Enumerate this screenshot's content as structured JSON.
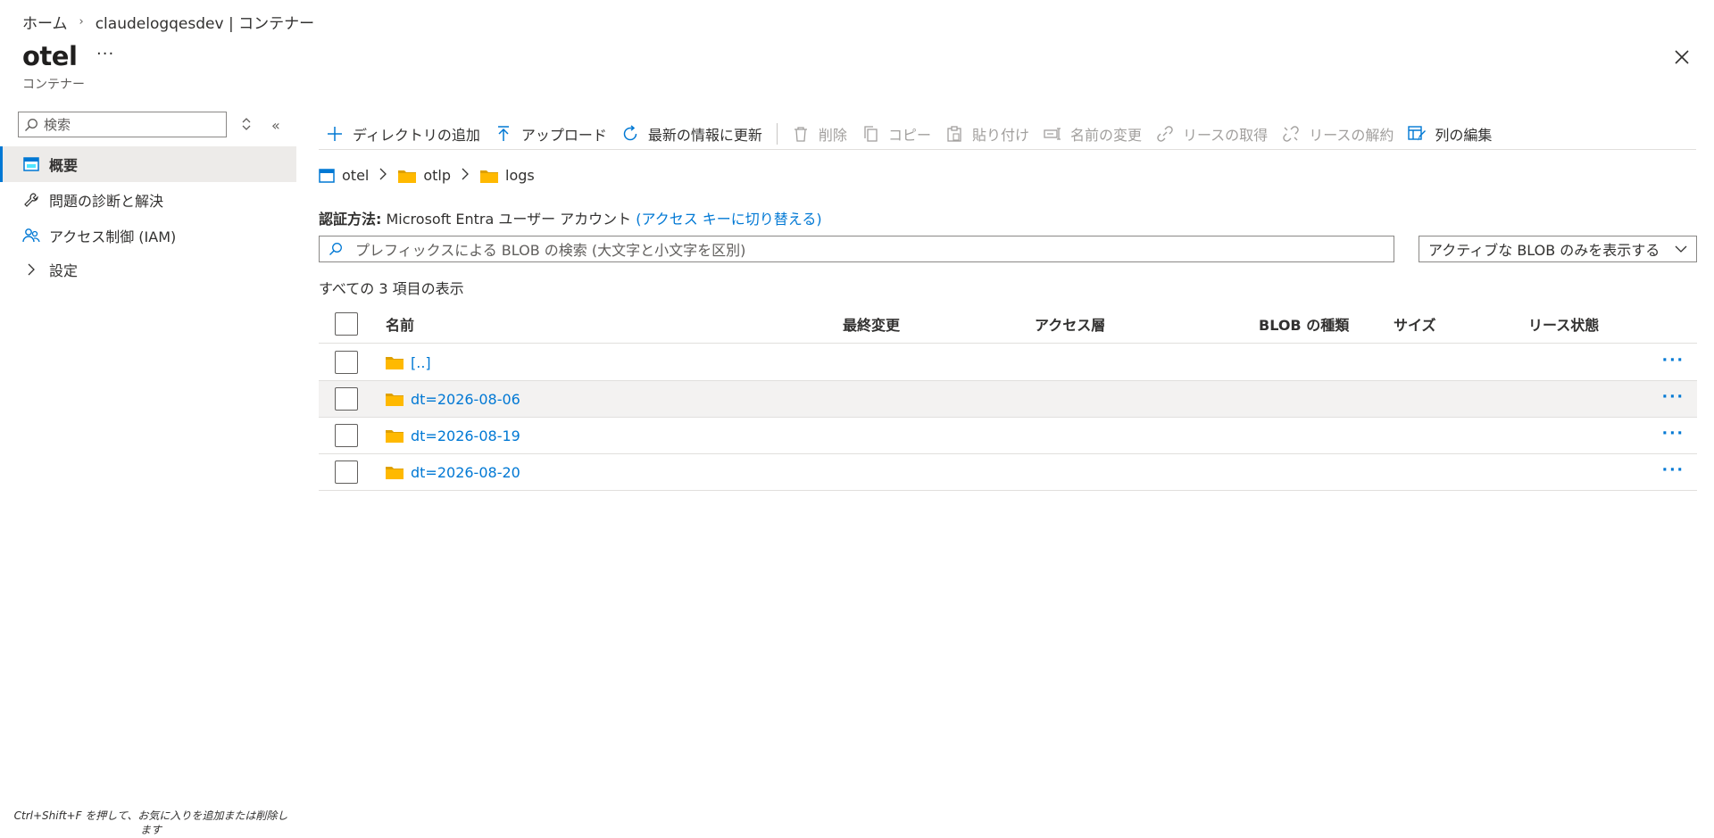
{
  "breadcrumb": {
    "home": "ホーム",
    "current": "claudelogqesdev | コンテナー"
  },
  "page": {
    "title": "otel",
    "more": "···",
    "subtitle": "コンテナー"
  },
  "nav": {
    "search_placeholder": "検索",
    "items": [
      {
        "label": "概要",
        "icon": "overview-icon",
        "active": true
      },
      {
        "label": "問題の診断と解決",
        "icon": "wrench-icon",
        "active": false
      },
      {
        "label": "アクセス制御 (IAM)",
        "icon": "people-icon",
        "active": false
      },
      {
        "label": "設定",
        "icon": "chevron-right-icon",
        "active": false
      }
    ],
    "hint": "Ctrl+Shift+F を押して、お気に入りを追加または削除します"
  },
  "toolbar": {
    "add_dir": "ディレクトリの追加",
    "upload": "アップロード",
    "refresh": "最新の情報に更新",
    "delete": "削除",
    "copy": "コピー",
    "paste": "貼り付け",
    "rename": "名前の変更",
    "acquire_lease": "リースの取得",
    "break_lease": "リースの解約",
    "edit_columns": "列の編集"
  },
  "path": {
    "container": "otel",
    "folder1": "otlp",
    "folder2": "logs"
  },
  "auth": {
    "label": "認証方法:",
    "value": "Microsoft Entra ユーザー アカウント",
    "switch_link": "(アクセス キーに切り替える)"
  },
  "blob_search": {
    "placeholder": "プレフィックスによる BLOB の検索 (大文字と小文字を区別)"
  },
  "blob_filter": {
    "selected": "アクティブな BLOB のみを表示する"
  },
  "count_text": "すべての 3 項目の表示",
  "table": {
    "columns": {
      "name": "名前",
      "modified": "最終変更",
      "tier": "アクセス層",
      "type": "BLOB の種類",
      "size": "サイズ",
      "lease": "リース状態"
    },
    "rows": [
      {
        "name": "[..]",
        "more": "···"
      },
      {
        "name": "dt=2026-08-06",
        "more": "···"
      },
      {
        "name": "dt=2026-08-19",
        "more": "···"
      },
      {
        "name": "dt=2026-08-20",
        "more": "···"
      }
    ]
  },
  "colors": {
    "accent": "#0078d4",
    "folder": "#ffb900",
    "hover_row": "#f3f2f1"
  }
}
